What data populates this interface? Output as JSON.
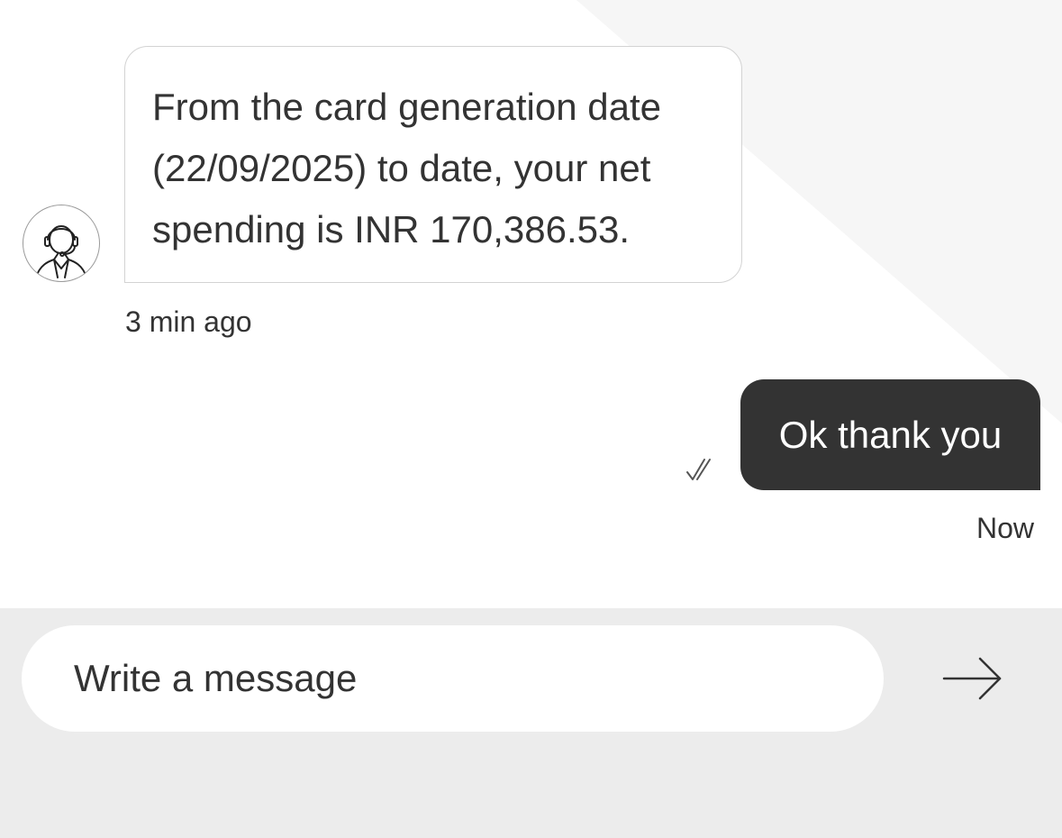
{
  "conversation": {
    "bot_message": {
      "lines": [
        "From the card generation date",
        "(22/09/2025) to date, your net",
        "spending is INR 170,386.53."
      ],
      "time": "3 min ago",
      "avatar_icon": "agent-headset-icon"
    },
    "user_message": {
      "text": "Ok thank you",
      "time": "Now",
      "status_icon": "double-check-icon"
    }
  },
  "composer": {
    "placeholder": "Write a message",
    "send_icon": "arrow-right-icon"
  },
  "colors": {
    "user_bubble": "#333333",
    "text": "#333333",
    "composer_background": "#ececec",
    "bubble_border": "#d3d3d3"
  }
}
